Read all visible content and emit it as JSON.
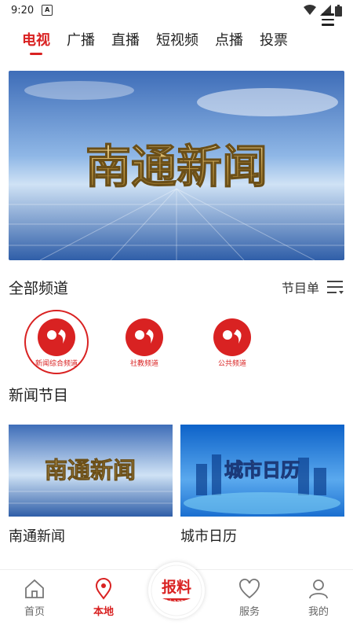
{
  "status": {
    "time": "9:20",
    "notif": "A"
  },
  "tabs": [
    {
      "label": "电视",
      "active": true
    },
    {
      "label": "广播"
    },
    {
      "label": "直播"
    },
    {
      "label": "短视频"
    },
    {
      "label": "点播"
    },
    {
      "label": "投票"
    }
  ],
  "banner": {
    "title": "南通新闻"
  },
  "channels_section": {
    "title": "全部频道",
    "schedule_label": "节目单"
  },
  "channels": [
    {
      "name": "新闻综合频道",
      "outlined": true
    },
    {
      "name": "社教频道"
    },
    {
      "name": "公共频道"
    }
  ],
  "programs_section": {
    "title": "新闻节目"
  },
  "programs": [
    {
      "title": "南通新闻",
      "thumb_text": "南通新闻"
    },
    {
      "title": "城市日历",
      "thumb_text": "城市日历"
    }
  ],
  "bottom_nav": [
    {
      "label": "首页",
      "icon": "home-icon"
    },
    {
      "label": "本地",
      "icon": "location-icon",
      "active": true
    },
    {
      "label": "服务",
      "icon": "heart-icon"
    },
    {
      "label": "我的",
      "icon": "user-icon"
    }
  ],
  "report": {
    "label": "报料",
    "hotline": "掌上12345"
  },
  "colors": {
    "accent": "#d92222"
  }
}
